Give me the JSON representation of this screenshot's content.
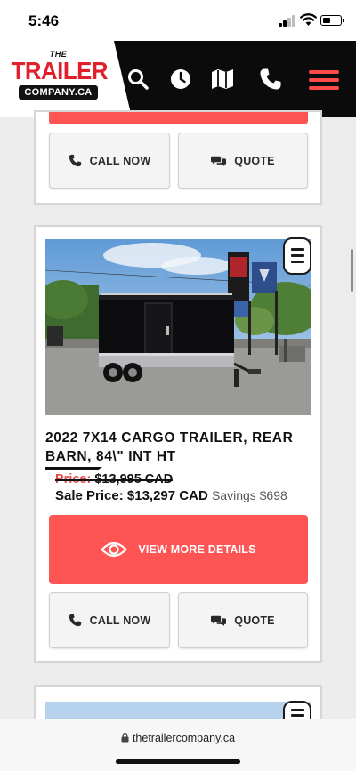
{
  "status_bar": {
    "time": "5:46"
  },
  "header": {
    "logo": {
      "the": "THE",
      "trailer": "TRAILER",
      "company": "COMPANY.CA"
    },
    "icons": [
      "search-icon",
      "clock-icon",
      "map-icon",
      "phone-icon",
      "hamburger-menu-icon"
    ],
    "accent_color": "#ff4a4a"
  },
  "cards": [
    {
      "call_label": "CALL NOW",
      "quote_label": "QUOTE"
    },
    {
      "title": "2022 7X14 CARGO TRAILER, REAR BARN, 84\\\" INT HT",
      "original_price_label": "Price:",
      "original_price_value": "$13,995 CAD",
      "sale_price_label": "Sale Price:",
      "sale_price_value": "$13,297 CAD",
      "savings": "Savings $698",
      "view_label": "VIEW MORE DETAILS",
      "call_label": "CALL NOW",
      "quote_label": "QUOTE"
    }
  ],
  "browser": {
    "url": "thetrailercompany.ca"
  },
  "colors": {
    "cta_red": "#ff5454",
    "price_red": "#e94949",
    "header_black": "#0b0b0b"
  }
}
